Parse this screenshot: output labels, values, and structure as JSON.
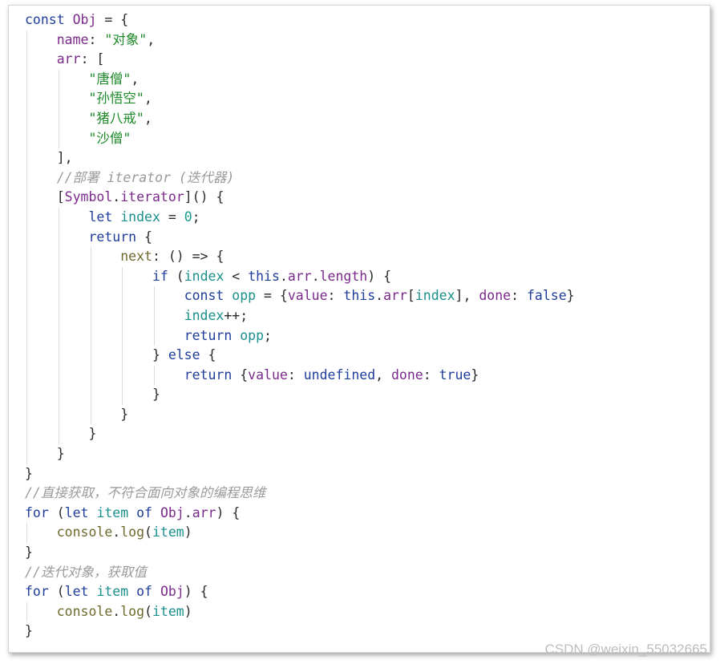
{
  "code_lines": [
    [
      {
        "t": "const ",
        "c": "kw"
      },
      {
        "t": "Obj",
        "c": "var"
      },
      {
        "t": " = {",
        "c": "plain"
      }
    ],
    [
      {
        "t": "    ",
        "c": "plain"
      },
      {
        "t": "name",
        "c": "prop"
      },
      {
        "t": ": ",
        "c": "plain"
      },
      {
        "t": "\"对象\"",
        "c": "str"
      },
      {
        "t": ",",
        "c": "plain"
      }
    ],
    [
      {
        "t": "    ",
        "c": "plain"
      },
      {
        "t": "arr",
        "c": "prop"
      },
      {
        "t": ": [",
        "c": "plain"
      }
    ],
    [
      {
        "t": "        ",
        "c": "plain"
      },
      {
        "t": "\"唐僧\"",
        "c": "str"
      },
      {
        "t": ",",
        "c": "plain"
      }
    ],
    [
      {
        "t": "        ",
        "c": "plain"
      },
      {
        "t": "\"孙悟空\"",
        "c": "str"
      },
      {
        "t": ",",
        "c": "plain"
      }
    ],
    [
      {
        "t": "        ",
        "c": "plain"
      },
      {
        "t": "\"猪八戒\"",
        "c": "str"
      },
      {
        "t": ",",
        "c": "plain"
      }
    ],
    [
      {
        "t": "        ",
        "c": "plain"
      },
      {
        "t": "\"沙僧\"",
        "c": "str"
      }
    ],
    [
      {
        "t": "    ],",
        "c": "plain"
      }
    ],
    [
      {
        "t": "    ",
        "c": "plain"
      },
      {
        "t": "//部署 iterator (迭代器)",
        "c": "cmt"
      }
    ],
    [
      {
        "t": "    [",
        "c": "plain"
      },
      {
        "t": "Symbol",
        "c": "var"
      },
      {
        "t": ".",
        "c": "plain"
      },
      {
        "t": "iterator",
        "c": "var"
      },
      {
        "t": "]() {",
        "c": "plain"
      }
    ],
    [
      {
        "t": "        ",
        "c": "plain"
      },
      {
        "t": "let ",
        "c": "kw"
      },
      {
        "t": "index",
        "c": "teal"
      },
      {
        "t": " = ",
        "c": "plain"
      },
      {
        "t": "0",
        "c": "num"
      },
      {
        "t": ";",
        "c": "plain"
      }
    ],
    [
      {
        "t": "        ",
        "c": "plain"
      },
      {
        "t": "return",
        "c": "kw"
      },
      {
        "t": " {",
        "c": "plain"
      }
    ],
    [
      {
        "t": "            ",
        "c": "plain"
      },
      {
        "t": "next",
        "c": "fn"
      },
      {
        "t": ": () => {",
        "c": "plain"
      }
    ],
    [
      {
        "t": "                ",
        "c": "plain"
      },
      {
        "t": "if",
        "c": "kw"
      },
      {
        "t": " (",
        "c": "plain"
      },
      {
        "t": "index",
        "c": "teal"
      },
      {
        "t": " < ",
        "c": "plain"
      },
      {
        "t": "this",
        "c": "kw"
      },
      {
        "t": ".",
        "c": "plain"
      },
      {
        "t": "arr",
        "c": "var"
      },
      {
        "t": ".",
        "c": "plain"
      },
      {
        "t": "length",
        "c": "var"
      },
      {
        "t": ") {",
        "c": "plain"
      }
    ],
    [
      {
        "t": "                    ",
        "c": "plain"
      },
      {
        "t": "const ",
        "c": "kw"
      },
      {
        "t": "opp",
        "c": "teal"
      },
      {
        "t": " = {",
        "c": "plain"
      },
      {
        "t": "value",
        "c": "prop"
      },
      {
        "t": ": ",
        "c": "plain"
      },
      {
        "t": "this",
        "c": "kw"
      },
      {
        "t": ".",
        "c": "plain"
      },
      {
        "t": "arr",
        "c": "var"
      },
      {
        "t": "[",
        "c": "plain"
      },
      {
        "t": "index",
        "c": "teal"
      },
      {
        "t": "], ",
        "c": "plain"
      },
      {
        "t": "done",
        "c": "prop"
      },
      {
        "t": ": ",
        "c": "plain"
      },
      {
        "t": "false",
        "c": "kw"
      },
      {
        "t": "}",
        "c": "plain"
      }
    ],
    [
      {
        "t": "                    ",
        "c": "plain"
      },
      {
        "t": "index",
        "c": "teal"
      },
      {
        "t": "++;",
        "c": "plain"
      }
    ],
    [
      {
        "t": "                    ",
        "c": "plain"
      },
      {
        "t": "return",
        "c": "kw"
      },
      {
        "t": " ",
        "c": "plain"
      },
      {
        "t": "opp",
        "c": "teal"
      },
      {
        "t": ";",
        "c": "plain"
      }
    ],
    [
      {
        "t": "                } ",
        "c": "plain"
      },
      {
        "t": "else",
        "c": "kw"
      },
      {
        "t": " {",
        "c": "plain"
      }
    ],
    [
      {
        "t": "                    ",
        "c": "plain"
      },
      {
        "t": "return",
        "c": "kw"
      },
      {
        "t": " {",
        "c": "plain"
      },
      {
        "t": "value",
        "c": "prop"
      },
      {
        "t": ": ",
        "c": "plain"
      },
      {
        "t": "undefined",
        "c": "kw"
      },
      {
        "t": ", ",
        "c": "plain"
      },
      {
        "t": "done",
        "c": "prop"
      },
      {
        "t": ": ",
        "c": "plain"
      },
      {
        "t": "true",
        "c": "kw"
      },
      {
        "t": "}",
        "c": "plain"
      }
    ],
    [
      {
        "t": "                }",
        "c": "plain"
      }
    ],
    [
      {
        "t": "            }",
        "c": "plain"
      }
    ],
    [
      {
        "t": "        }",
        "c": "plain"
      }
    ],
    [
      {
        "t": "    }",
        "c": "plain"
      }
    ],
    [
      {
        "t": "}",
        "c": "plain"
      }
    ],
    [
      {
        "t": "//直接获取，不符合面向对象的编程思维",
        "c": "cmt"
      }
    ],
    [
      {
        "t": "for",
        "c": "kw"
      },
      {
        "t": " (",
        "c": "plain"
      },
      {
        "t": "let ",
        "c": "kw"
      },
      {
        "t": "item",
        "c": "teal"
      },
      {
        "t": " ",
        "c": "plain"
      },
      {
        "t": "of",
        "c": "kw"
      },
      {
        "t": " ",
        "c": "plain"
      },
      {
        "t": "Obj",
        "c": "var"
      },
      {
        "t": ".",
        "c": "plain"
      },
      {
        "t": "arr",
        "c": "var"
      },
      {
        "t": ") {",
        "c": "plain"
      }
    ],
    [
      {
        "t": "    ",
        "c": "plain"
      },
      {
        "t": "console",
        "c": "fn"
      },
      {
        "t": ".",
        "c": "plain"
      },
      {
        "t": "log",
        "c": "fn"
      },
      {
        "t": "(",
        "c": "plain"
      },
      {
        "t": "item",
        "c": "teal"
      },
      {
        "t": ")",
        "c": "plain"
      }
    ],
    [
      {
        "t": "}",
        "c": "plain"
      }
    ],
    [
      {
        "t": "//迭代对象，获取值",
        "c": "cmt"
      }
    ],
    [
      {
        "t": "for",
        "c": "kw"
      },
      {
        "t": " (",
        "c": "plain"
      },
      {
        "t": "let ",
        "c": "kw"
      },
      {
        "t": "item",
        "c": "teal"
      },
      {
        "t": " ",
        "c": "plain"
      },
      {
        "t": "of",
        "c": "kw"
      },
      {
        "t": " ",
        "c": "plain"
      },
      {
        "t": "Obj",
        "c": "var"
      },
      {
        "t": ") {",
        "c": "plain"
      }
    ],
    [
      {
        "t": "    ",
        "c": "plain"
      },
      {
        "t": "console",
        "c": "fn"
      },
      {
        "t": ".",
        "c": "plain"
      },
      {
        "t": "log",
        "c": "fn"
      },
      {
        "t": "(",
        "c": "plain"
      },
      {
        "t": "item",
        "c": "teal"
      },
      {
        "t": ")",
        "c": "plain"
      }
    ],
    [
      {
        "t": "}",
        "c": "plain"
      }
    ]
  ],
  "watermark": "CSDN @weixin_55032665"
}
